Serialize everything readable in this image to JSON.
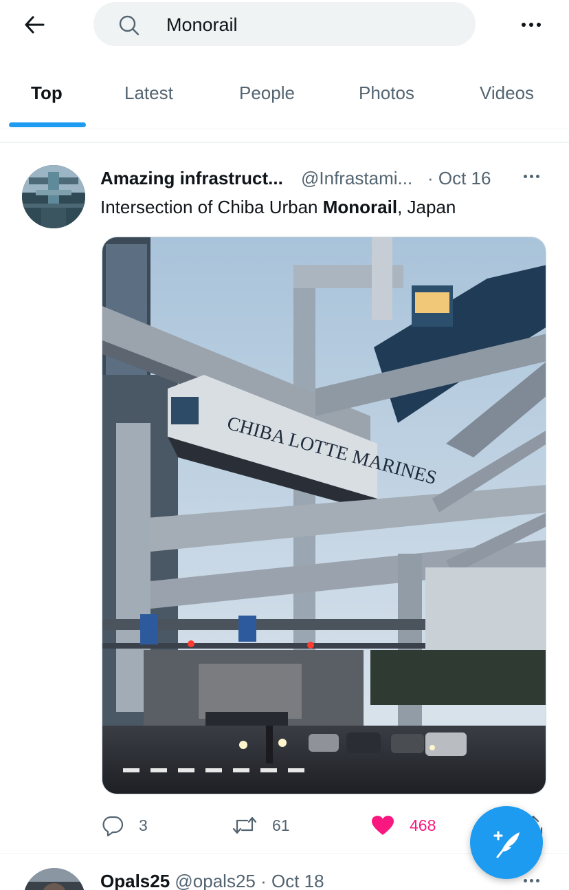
{
  "search": {
    "query": "Monorail"
  },
  "tabs": [
    {
      "label": "Top",
      "active": true
    },
    {
      "label": "Latest",
      "active": false
    },
    {
      "label": "People",
      "active": false
    },
    {
      "label": "Photos",
      "active": false
    },
    {
      "label": "Videos",
      "active": false
    }
  ],
  "tweet": {
    "name": "Amazing infrastruct...",
    "handle": "@Infrastami...",
    "date": "· Oct 16",
    "text_before": "Intersection of Chiba Urban ",
    "text_bold": "Monorail",
    "text_after": ", Japan",
    "image_text": "CHIBA LOTTE MARINES",
    "replies": "3",
    "retweets": "61",
    "likes": "468",
    "liked": true
  },
  "next_tweet": {
    "name": "Opals25",
    "handle": "@opals25",
    "date": "· Oct 18"
  },
  "colors": {
    "accent": "#1d9bf0",
    "like": "#f91880",
    "muted_text": "#536471",
    "primary_text": "#0f1419",
    "search_bg": "#eff3f4"
  },
  "icons": {
    "back": "arrow-left-icon",
    "search": "search-icon",
    "more": "more-horizontal-icon",
    "reply": "reply-icon",
    "retweet": "retweet-icon",
    "like": "heart-filled-icon",
    "share": "share-icon",
    "compose": "compose-feather-icon"
  }
}
